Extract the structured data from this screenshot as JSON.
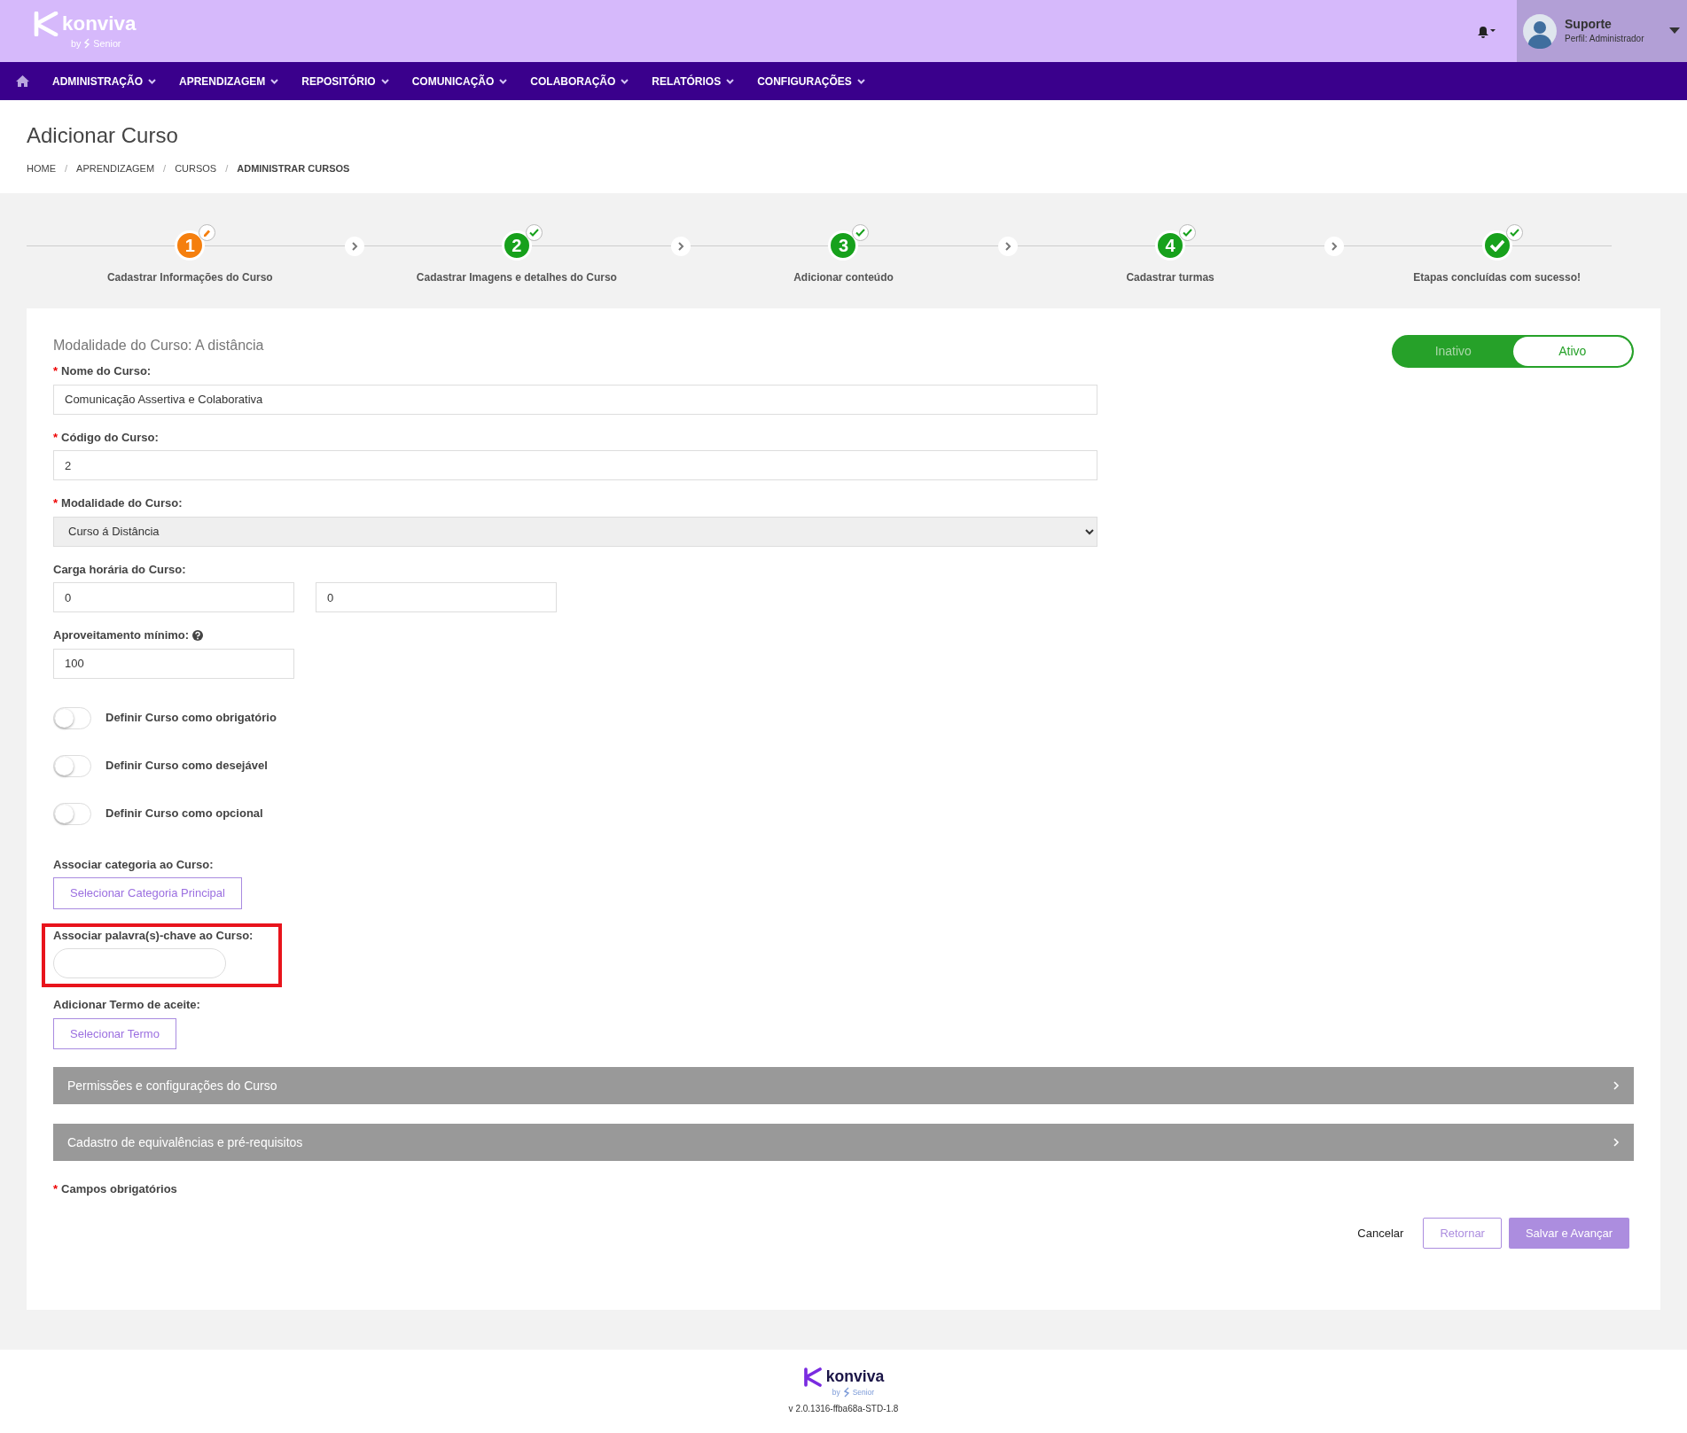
{
  "header": {
    "logo": {
      "name": "konviva",
      "byline": "by",
      "brand": "Senior"
    },
    "user": {
      "name": "Suporte",
      "profile": "Perfil: Administrador"
    }
  },
  "nav": {
    "items": [
      {
        "label": "ADMINISTRAÇÃO"
      },
      {
        "label": "APRENDIZAGEM"
      },
      {
        "label": "REPOSITÓRIO"
      },
      {
        "label": "COMUNICAÇÃO"
      },
      {
        "label": "COLABORAÇÃO"
      },
      {
        "label": "RELATÓRIOS"
      },
      {
        "label": "CONFIGURAÇÕES"
      }
    ]
  },
  "page": {
    "title": "Adicionar Curso",
    "breadcrumb": [
      {
        "label": "HOME",
        "current": false
      },
      {
        "separator": "/",
        "label": "APRENDIZAGEM",
        "current": false
      },
      {
        "separator": "/",
        "label": "CURSOS",
        "current": false
      },
      {
        "separator": "/",
        "label": "ADMINISTRAR CURSOS",
        "current": true
      }
    ]
  },
  "steps": [
    {
      "kind": "numbered",
      "number": "1",
      "label": "Cadastrar Informações do Curso",
      "editing": true
    },
    {
      "kind": "numbered",
      "number": "2",
      "label": "Cadastrar Imagens e detalhes do Curso",
      "editing": false
    },
    {
      "kind": "numbered",
      "number": "3",
      "label": "Adicionar conteúdo",
      "editing": false
    },
    {
      "kind": "numbered",
      "number": "4",
      "label": "Cadastrar turmas",
      "editing": false
    },
    {
      "kind": "final",
      "label": "Etapas concluídas com sucesso!",
      "editing": false
    }
  ],
  "form": {
    "subtitle": "Modalidade do Curso: A distância",
    "status_switch": [
      {
        "label": "Inativo",
        "selected": false
      },
      {
        "label": "Ativo",
        "selected": true
      }
    ],
    "fields": [
      {
        "kind": "text",
        "required_mark": "*",
        "label": "Nome do Curso:",
        "value": "Comunicação Assertiva e Colaborativa"
      },
      {
        "kind": "text",
        "required_mark": "*",
        "label": "Código do Curso:",
        "value": "2"
      },
      {
        "kind": "select",
        "required_mark": "*",
        "label": "Modalidade do Curso:",
        "value": "Curso á Distância"
      },
      {
        "kind": "pair",
        "label": "Carga horária do Curso:",
        "values": [
          "0",
          "0"
        ]
      },
      {
        "kind": "short",
        "label": "Aproveitamento mínimo:",
        "help": true,
        "value": "100"
      }
    ],
    "switches": [
      {
        "label": "Definir Curso como obrigatório",
        "on": false
      },
      {
        "label": "Definir Curso como desejável",
        "on": false
      },
      {
        "label": "Definir Curso como opcional",
        "on": false
      }
    ],
    "pickers": [
      {
        "kind": "button",
        "label": "Associar categoria ao Curso:",
        "button": "Selecionar Categoria Principal",
        "highlighted": false
      },
      {
        "kind": "tags",
        "label": "Associar palavra(s)-chave ao Curso:",
        "highlighted": true
      },
      {
        "kind": "button",
        "label": "Adicionar Termo de aceite:",
        "button": "Selecionar Termo",
        "highlighted": false
      }
    ],
    "sections": [
      {
        "title": "Permissões e configurações do Curso"
      },
      {
        "title": "Cadastro de equivalências e pré-requisitos"
      }
    ],
    "required_note": {
      "mark": "*",
      "text": "Campos obrigatórios"
    },
    "actions": [
      {
        "kind": "link",
        "label": "Cancelar"
      },
      {
        "kind": "outline",
        "label": "Retornar"
      },
      {
        "kind": "primary",
        "label": "Salvar e Avançar"
      }
    ]
  },
  "footer": {
    "logo": {
      "name": "konviva",
      "byline": "by",
      "brand": "Senior"
    },
    "version": "v 2.0.1316-ffba68a-STD-1.8"
  }
}
